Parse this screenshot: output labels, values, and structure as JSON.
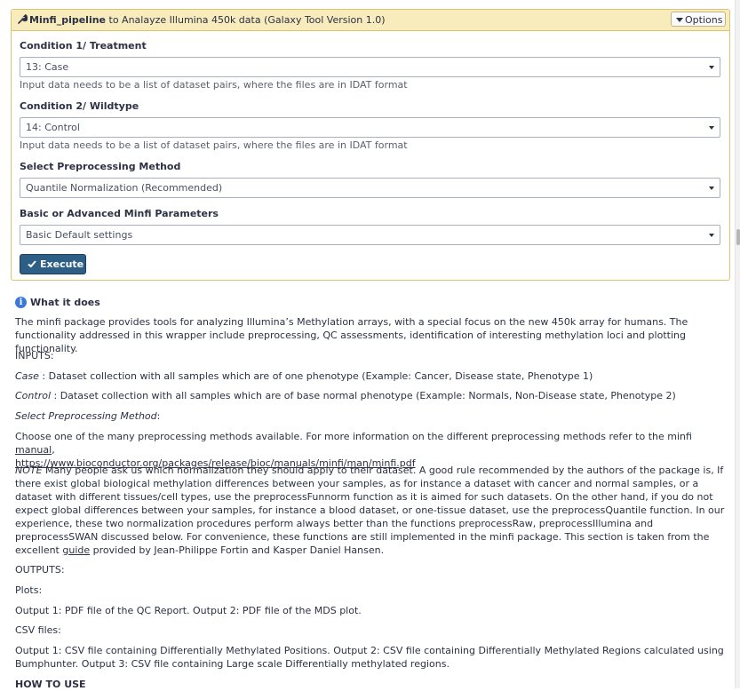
{
  "tool": {
    "name": "Minfi_pipeline",
    "title_rest": " to Analayze Illumina 450k data (Galaxy Tool Version 1.0)",
    "options_label": "Options"
  },
  "fields": [
    {
      "label": "Condition 1/ Treatment",
      "value": "13: Case",
      "help": "Input data needs to be a list of dataset pairs, where the files are in IDAT format"
    },
    {
      "label": "Condition 2/ Wildtype",
      "value": "14: Control",
      "help": "Input data needs to be a list of dataset pairs, where the files are in IDAT format"
    },
    {
      "label": "Select Preprocessing Method",
      "value": "Quantile Normalization (Recommended)"
    },
    {
      "label": "Basic or Advanced Minfi Parameters",
      "value": "Basic Default settings"
    }
  ],
  "execute_label": "Execute",
  "help": {
    "what_it_does": "What it does",
    "intro": "The minfi package provides tools for analyzing Illumina’s Methylation arrays, with a special focus on the new 450k array for humans. The functionality addressed in this wrapper include preprocessing, QC assessments, identification of interesting methylation loci and plotting functionality.",
    "inputs_heading": "INPUTS:",
    "case_term": "Case",
    "case_text": " : Dataset collection with all samples which are of one phenotype (Example: Cancer, Disease state, Phenotype 1)",
    "control_term": "Control",
    "control_text": " : Dataset collection with all samples which are of base normal phenotype (Example: Normals, Non-Disease state, Phenotype 2)",
    "select_method": "Select Preprocessing Method",
    "select_method_colon": ":",
    "choose_text": "Choose one of the many preprocessing methods available. For more information on the different preprocessing methods refer to the minfi ",
    "manual_link": "manual",
    "choose_comma": ",",
    "manual_url": "https://www.bioconductor.org/packages/release/bioc/manuals/minfi/man/minfi.pdf",
    "note_term": "NOTE",
    "note_text": " Many people ask us which normalization they should apply to their dataset. A good rule recommended by the authors of the package is, If there exist global biological methylation differences between your samples, as for instance a dataset with cancer and normal samples, or a dataset with different tissues/cell types, use the preprocessFunnorm function as it is aimed for such datasets. On the other hand, if you do not expect global differences between your samples, for instance a blood dataset, or one-tissue dataset, use the preprocessQuantile function. In our experience, these two normalization procedures perform always better than the functions preprocessRaw, preprocessIllumina and preprocessSWAN discussed below. For convenience, these functions are still implemented in the minfi package. This section is taken from the excellent ",
    "guide_link": "guide",
    "note_end": " provided by Jean-Philippe Fortin and Kasper Daniel Hansen.",
    "outputs_heading": "OUTPUTS:",
    "plots": "Plots:",
    "plots_text": "Output 1: PDF file of the QC Report. Output 2: PDF file of the MDS plot.",
    "csv": "CSV files:",
    "csv_text": "Output 1: CSV file containing Differentially Methylated Positions. Output 2: CSV file containing Differentially Methylated Regions calculated using Bumphunter. Output 3: CSV file containing Large scale Differentially methylated regions.",
    "how_to_use": "HOW TO USE"
  }
}
